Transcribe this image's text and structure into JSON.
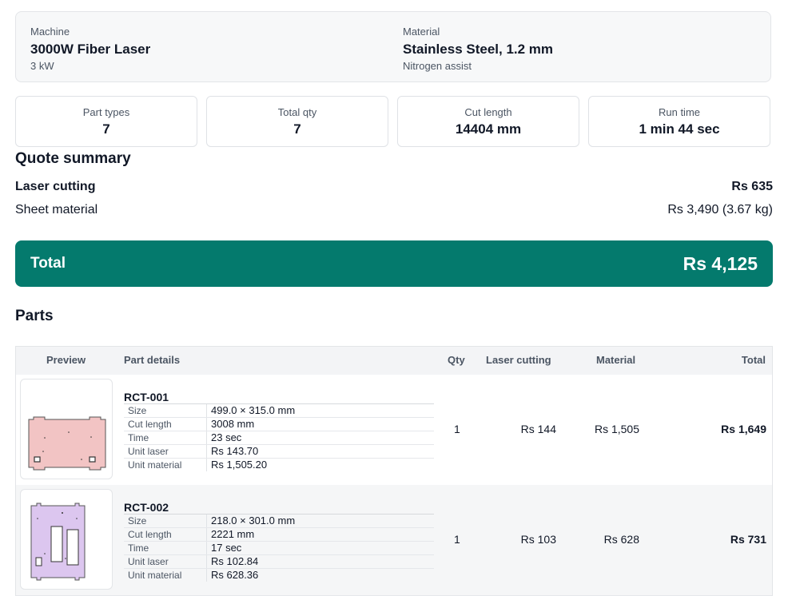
{
  "machine": {
    "label": "Machine",
    "name": "3000W Fiber Laser",
    "power": "3 kW"
  },
  "material": {
    "label": "Material",
    "name": "Stainless Steel, 1.2 mm",
    "assist": "Nitrogen assist"
  },
  "stats": [
    {
      "label": "Part types",
      "value": "7"
    },
    {
      "label": "Total qty",
      "value": "7"
    },
    {
      "label": "Cut length",
      "value": "14404 mm"
    },
    {
      "label": "Run time",
      "value": "1 min 44 sec"
    }
  ],
  "quote": {
    "title": "Quote summary",
    "laser_label": "Laser cutting",
    "laser_value": "Rs 635",
    "sheet_label": "Sheet material",
    "sheet_value": "Rs 3,490 (3.67 kg)",
    "total_label": "Total",
    "total_value": "Rs 4,125"
  },
  "parts": {
    "title": "Parts",
    "headers": {
      "preview": "Preview",
      "details": "Part details",
      "qty": "Qty",
      "laser": "Laser cutting",
      "material": "Material",
      "total": "Total"
    },
    "rows": [
      {
        "id": "RCT-001",
        "specs": [
          {
            "k": "Size",
            "v": "499.0 × 315.0 mm"
          },
          {
            "k": "Cut length",
            "v": "3008 mm"
          },
          {
            "k": "Time",
            "v": "23 sec"
          },
          {
            "k": "Unit laser",
            "v": "Rs 143.70"
          },
          {
            "k": "Unit material",
            "v": "Rs 1,505.20"
          }
        ],
        "qty": "1",
        "laser": "Rs 144",
        "material": "Rs 1,505",
        "total": "Rs 1,649",
        "preview_color": "#f2c4c4"
      },
      {
        "id": "RCT-002",
        "specs": [
          {
            "k": "Size",
            "v": "218.0 × 301.0 mm"
          },
          {
            "k": "Cut length",
            "v": "2221 mm"
          },
          {
            "k": "Time",
            "v": "17 sec"
          },
          {
            "k": "Unit laser",
            "v": "Rs 102.84"
          },
          {
            "k": "Unit material",
            "v": "Rs 628.36"
          }
        ],
        "qty": "1",
        "laser": "Rs 103",
        "material": "Rs 628",
        "total": "Rs 731",
        "preview_color": "#dcc6ef"
      }
    ]
  },
  "colors": {
    "accent": "#047a6d"
  }
}
